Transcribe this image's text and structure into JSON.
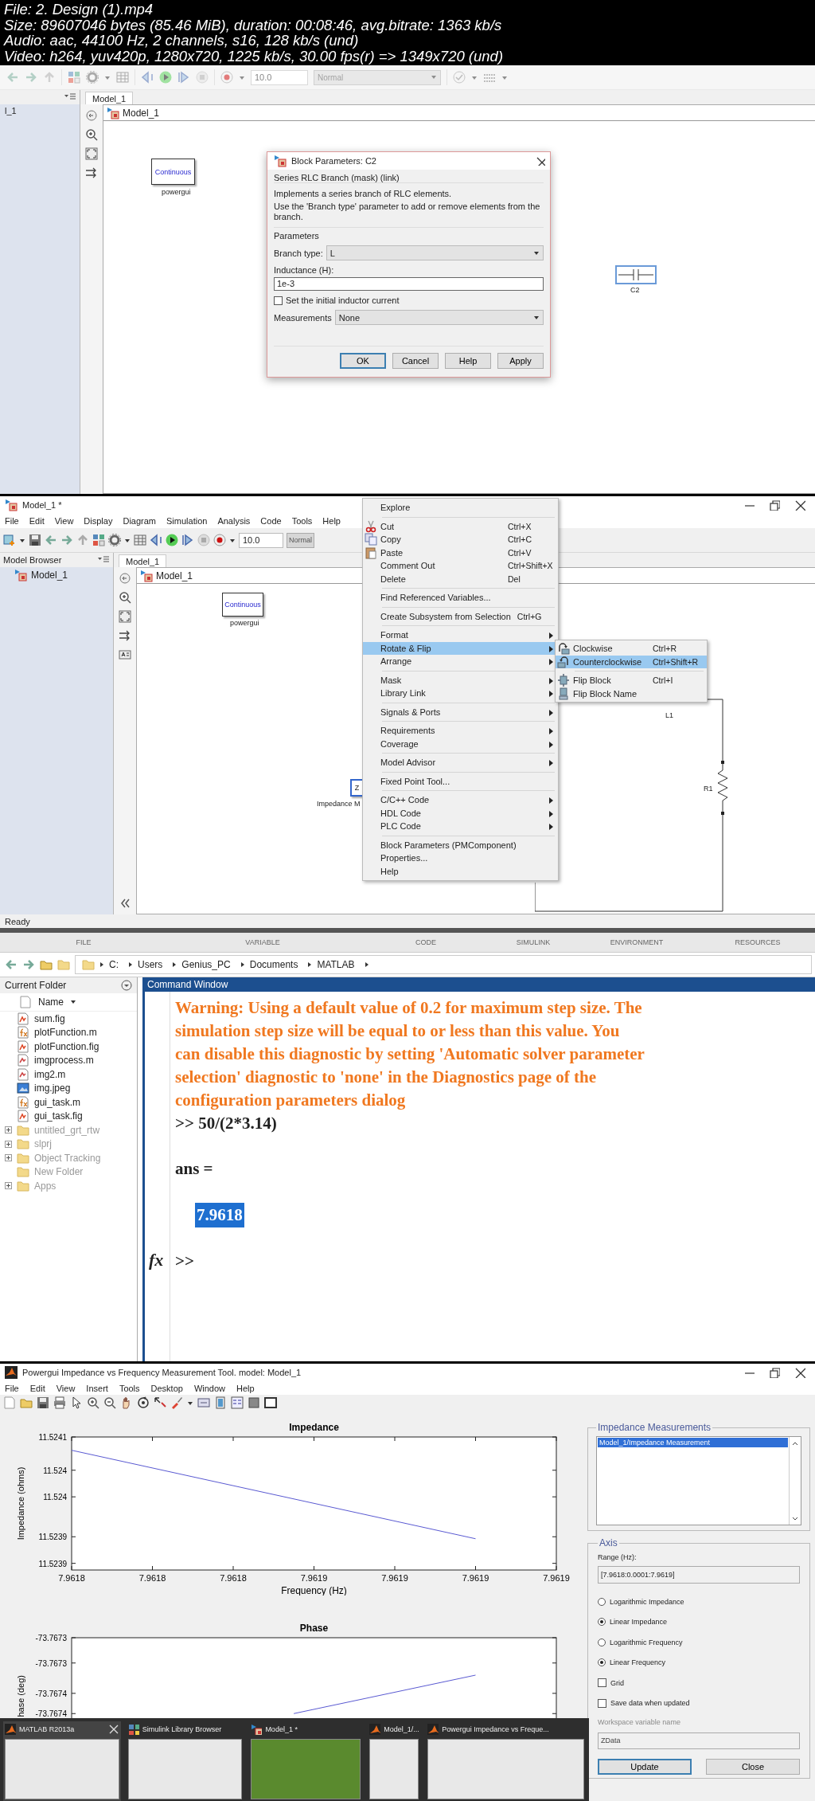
{
  "video_info": [
    "File: 2. Design (1).mp4",
    "Size: 89607046 bytes (85.46 MiB), duration: 00:08:46, avg.bitrate: 1363 kb/s",
    "Audio: aac, 44100 Hz, 2 channels, s16, 128 kb/s (und)",
    "Video: h264, yuv420p, 1280x720, 1225 kb/s, 30.00 fps(r) => 1349x720 (und)"
  ],
  "frame_1": {
    "toolbar": {
      "stop_time": "10.0",
      "mode": "Normal"
    },
    "model_browser": {
      "items": [
        "l_1"
      ]
    },
    "tab": "Model_1",
    "breadcrumb": "Model_1",
    "blocks": [
      {
        "kind": "powergui",
        "text": "Continuous",
        "label": "powergui"
      },
      {
        "kind": "capacitor",
        "label": "C2",
        "selected": true
      }
    ],
    "dialog": {
      "title": "Block Parameters: C2",
      "mask": "Series RLC Branch (mask) (link)",
      "description": [
        "Implements a series branch of RLC elements.",
        "Use the 'Branch type' parameter to add or remove elements from the branch."
      ],
      "section": "Parameters",
      "fields": [
        {
          "kind": "dropdown",
          "label": "Branch type:",
          "value": "L"
        },
        {
          "kind": "text",
          "label": "Inductance (H):",
          "value": "1e-3"
        },
        {
          "kind": "checkbox",
          "label": "Set the initial inductor current",
          "checked": false
        },
        {
          "kind": "dropdown",
          "label": "Measurements",
          "value": "None"
        }
      ],
      "buttons": [
        {
          "label": "OK",
          "default": true
        },
        {
          "label": "Cancel",
          "default": false
        },
        {
          "label": "Help",
          "default": false
        },
        {
          "label": "Apply",
          "default": false
        }
      ]
    }
  },
  "frame_2": {
    "window_title": "Model_1 *",
    "menu": [
      "File",
      "Edit",
      "View",
      "Display",
      "Diagram",
      "Simulation",
      "Analysis",
      "Code",
      "Tools",
      "Help"
    ],
    "toolbar": {
      "stop_time": "10.0",
      "mode": "Normal"
    },
    "model_browser": {
      "title": "Model Browser",
      "items": [
        "Model_1"
      ]
    },
    "tab": "Model_1",
    "breadcrumb": "Model_1",
    "blocks": [
      {
        "kind": "powergui",
        "text": "Continuous",
        "label": "powergui"
      },
      {
        "kind": "impedance",
        "text": "Z",
        "label": "Impedance M"
      },
      {
        "kind": "inductor",
        "label": "L1"
      },
      {
        "kind": "resistor",
        "label": "R1"
      }
    ],
    "status": "Ready",
    "context_menu": {
      "groups": [
        [
          {
            "label": "Explore",
            "kind": "plain",
            "submenu": false,
            "selected": false
          }
        ],
        [
          {
            "label": "Cut",
            "shortcut": "Ctrl+X",
            "kind": "cut",
            "submenu": false,
            "selected": false
          },
          {
            "label": "Copy",
            "shortcut": "Ctrl+C",
            "kind": "copy",
            "submenu": false,
            "selected": false
          },
          {
            "label": "Paste",
            "shortcut": "Ctrl+V",
            "kind": "paste",
            "submenu": false,
            "selected": false
          },
          {
            "label": "Comment Out",
            "shortcut": "Ctrl+Shift+X",
            "kind": "plain",
            "submenu": false,
            "selected": false
          },
          {
            "label": "Delete",
            "shortcut": "Del",
            "kind": "plain",
            "submenu": false,
            "selected": false
          }
        ],
        [
          {
            "label": "Find Referenced Variables...",
            "kind": "plain",
            "submenu": false,
            "selected": false
          }
        ],
        [
          {
            "label": "Create Subsystem from Selection",
            "shortcut": "Ctrl+G",
            "kind": "plain",
            "submenu": false,
            "selected": false
          }
        ],
        [
          {
            "label": "Format",
            "kind": "plain",
            "submenu": true,
            "selected": false
          },
          {
            "label": "Rotate & Flip",
            "kind": "plain",
            "submenu": true,
            "selected": true
          },
          {
            "label": "Arrange",
            "kind": "plain",
            "submenu": true,
            "selected": false
          }
        ],
        [
          {
            "label": "Mask",
            "kind": "plain",
            "submenu": true,
            "selected": false
          },
          {
            "label": "Library Link",
            "kind": "plain",
            "submenu": true,
            "selected": false
          }
        ],
        [
          {
            "label": "Signals & Ports",
            "kind": "plain",
            "submenu": true,
            "selected": false
          }
        ],
        [
          {
            "label": "Requirements",
            "kind": "plain",
            "submenu": true,
            "selected": false
          },
          {
            "label": "Coverage",
            "kind": "plain",
            "submenu": true,
            "selected": false
          }
        ],
        [
          {
            "label": "Model Advisor",
            "kind": "plain",
            "submenu": true,
            "selected": false
          }
        ],
        [
          {
            "label": "Fixed Point Tool...",
            "kind": "plain",
            "submenu": false,
            "selected": false
          }
        ],
        [
          {
            "label": "C/C++ Code",
            "kind": "plain",
            "submenu": true,
            "selected": false
          },
          {
            "label": "HDL Code",
            "kind": "plain",
            "submenu": true,
            "selected": false
          },
          {
            "label": "PLC Code",
            "kind": "plain",
            "submenu": true,
            "selected": false
          }
        ],
        [
          {
            "label": "Block Parameters (PMComponent)",
            "kind": "plain",
            "submenu": false,
            "selected": false
          },
          {
            "label": "Properties...",
            "kind": "plain",
            "submenu": false,
            "selected": false
          },
          {
            "label": "Help",
            "kind": "plain",
            "submenu": false,
            "selected": false
          }
        ]
      ],
      "submenu": [
        [
          {
            "label": "Clockwise",
            "shortcut": "Ctrl+R",
            "kind": "rotate_cw",
            "selected": false
          },
          {
            "label": "Counterclockwise",
            "shortcut": "Ctrl+Shift+R",
            "kind": "rotate_ccw",
            "selected": true
          }
        ],
        [
          {
            "label": "Flip Block",
            "shortcut": "Ctrl+I",
            "kind": "flip",
            "selected": false
          },
          {
            "label": "Flip Block Name",
            "kind": "flip_name",
            "selected": false
          }
        ]
      ]
    }
  },
  "frame_3": {
    "ribbon_sections": [
      "FILE",
      "VARIABLE",
      "CODE",
      "SIMULINK",
      "ENVIRONMENT",
      "RESOURCES"
    ],
    "path": [
      "C:",
      "Users",
      "Genius_PC",
      "Documents",
      "MATLAB"
    ],
    "current_folder": {
      "title": "Current Folder",
      "column": "Name",
      "files": [
        {
          "name": "sum.fig",
          "kind": "fig"
        },
        {
          "name": "plotFunction.m",
          "kind": "function"
        },
        {
          "name": "plotFunction.fig",
          "kind": "fig"
        },
        {
          "name": "imgprocess.m",
          "kind": "script"
        },
        {
          "name": "img2.m",
          "kind": "script"
        },
        {
          "name": "img.jpeg",
          "kind": "image"
        },
        {
          "name": "gui_task.m",
          "kind": "function"
        },
        {
          "name": "gui_task.fig",
          "kind": "fig"
        },
        {
          "name": "untitled_grt_rtw",
          "kind": "folder",
          "expandable": true
        },
        {
          "name": "slprj",
          "kind": "folder",
          "expandable": true
        },
        {
          "name": "Object Tracking",
          "kind": "folder",
          "expandable": true
        },
        {
          "name": "New Folder",
          "kind": "folder",
          "expandable": false
        },
        {
          "name": "Apps",
          "kind": "folder",
          "expandable": true
        }
      ]
    },
    "command_window": {
      "title": "Command Window",
      "warning": [
        "Warning: Using a default value of 0.2 for maximum step size.  The",
        "simulation step size will be equal to or less than this value.  You",
        "can disable this diagnostic by setting 'Automatic solver parameter",
        "selection' diagnostic to 'none' in the Diagnostics page of the",
        "configuration parameters dialog"
      ],
      "command": ">> 50/(2*3.14)",
      "result_label": "ans =",
      "result": {
        "text": "7.9618",
        "selected": true
      },
      "prompt_icon": "fx",
      "prompt": ">>"
    }
  },
  "frame_4": {
    "window_title": "Powergui Impedance vs Frequency Measurement Tool.  model: Model_1",
    "menu": [
      "File",
      "Edit",
      "View",
      "Insert",
      "Tools",
      "Desktop",
      "Window",
      "Help"
    ],
    "impedance_chart": {
      "chart_data": {
        "type": "line",
        "title": "Impedance",
        "xlabel": "Frequency (Hz)",
        "ylabel": "Impedance (ohms)",
        "x": [
          7.9618,
          7.9619
        ],
        "series": [
          {
            "color": "#5a5ad2",
            "values": [
              11.52403,
              11.523897
            ]
          }
        ],
        "xlim": [
          7.9618,
          7.96192
        ],
        "ylim": [
          11.52385,
          11.52405
        ],
        "xticks": [
          {
            "value": 7.9618,
            "label": "7.9618"
          },
          {
            "value": 7.96182,
            "label": "7.9618"
          },
          {
            "value": 7.96184,
            "label": "7.9618"
          },
          {
            "value": 7.96186,
            "label": "7.9619"
          },
          {
            "value": 7.96188,
            "label": "7.9619"
          },
          {
            "value": 7.9619,
            "label": "7.9619"
          },
          {
            "value": 7.96192,
            "label": "7.9619"
          }
        ],
        "yticks": [
          {
            "value": 11.52386,
            "label": "11.5239"
          },
          {
            "value": 11.5239,
            "label": "11.5239"
          },
          {
            "value": 11.52396,
            "label": "11.524"
          },
          {
            "value": 11.524,
            "label": "11.524"
          },
          {
            "value": 11.52405,
            "label": "11.5241"
          }
        ]
      }
    },
    "phase_chart": {
      "chart_data": {
        "type": "line",
        "title": "Phase",
        "ylabel": "hase (deg)",
        "x": [
          7.961855,
          7.9619
        ],
        "series": [
          {
            "color": "#5a5ad2",
            "values": [
              -73.7674,
              -73.767324
            ]
          }
        ],
        "xlim": [
          7.9618,
          7.96192
        ],
        "ylim": [
          -73.76745,
          -73.76725
        ],
        "yticks": [
          {
            "value": -73.7674,
            "label": "-73.7674"
          },
          {
            "value": -73.76736,
            "label": "-73.7674"
          },
          {
            "value": -73.7673,
            "label": "-73.7673"
          },
          {
            "value": -73.76725,
            "label": "-73.7673"
          }
        ]
      }
    },
    "measurements": {
      "title": "Impedance Measurements",
      "items": [
        {
          "label": "Model_1/Impedance Measurement",
          "selected": true
        }
      ]
    },
    "axis": {
      "title": "Axis",
      "range_label": "Range (Hz):",
      "range": "[7.9618:0.0001:7.9619]",
      "options": [
        {
          "kind": "radio",
          "label": "Logarithmic Impedance",
          "selected": false
        },
        {
          "kind": "radio",
          "label": "Linear Impedance",
          "selected": true
        },
        {
          "kind": "radio",
          "label": "Logarithmic Frequency",
          "selected": false
        },
        {
          "kind": "radio",
          "label": "Linear Frequency",
          "selected": true
        },
        {
          "kind": "checkbox",
          "label": "Grid",
          "checked": false
        },
        {
          "kind": "checkbox",
          "label": "Save data when updated",
          "checked": false
        }
      ],
      "workspace": {
        "label": "Workspace variable name",
        "value": "ZData",
        "disabled": true
      },
      "buttons": [
        {
          "label": "Update",
          "default": true
        },
        {
          "label": "Close",
          "default": false
        }
      ]
    },
    "taskbar": [
      {
        "title": "MATLAB R2013a",
        "kind": "matlab",
        "closable": true
      },
      {
        "title": "Simulink Library Browser",
        "kind": "simulink",
        "closable": false
      },
      {
        "title": "Model_1 *",
        "kind": "model",
        "closable": false
      },
      {
        "title": "Model_1/...",
        "kind": "matlab",
        "closable": false
      },
      {
        "title": "Powergui Impedance vs Freque...",
        "kind": "matlab",
        "closable": false
      }
    ]
  }
}
